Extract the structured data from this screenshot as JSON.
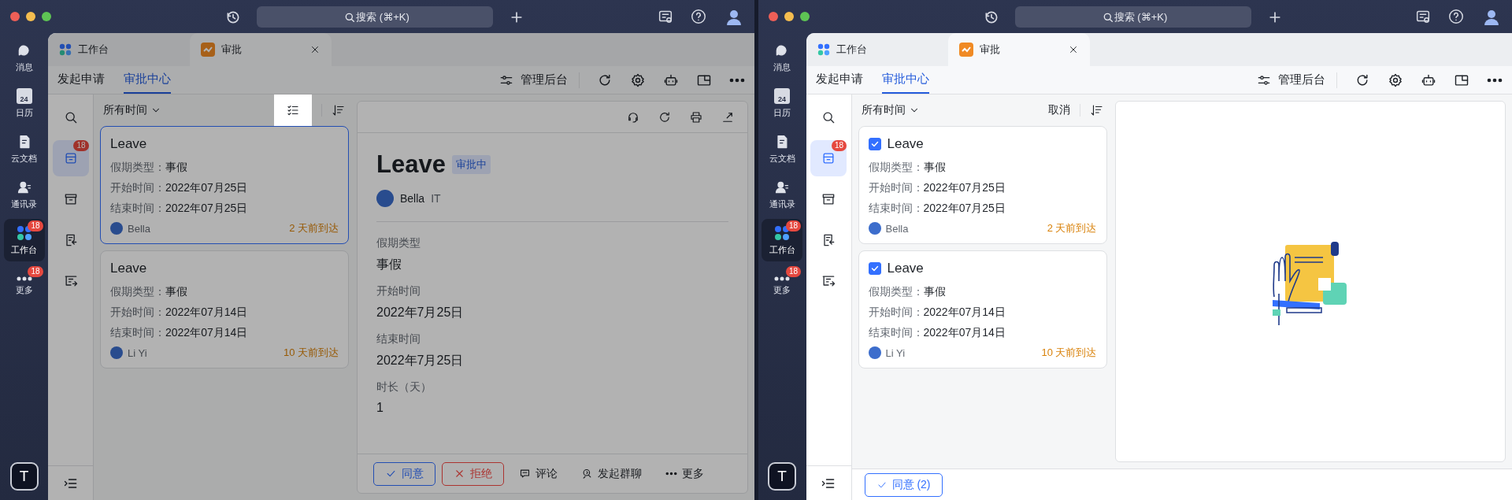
{
  "windows": [
    {
      "dimmed": true,
      "titlebar": {
        "search": {
          "placeholder": "搜索 (⌘+K)"
        }
      },
      "rail": {
        "items": [
          {
            "kind": "chat",
            "label": "消息",
            "selected": false
          },
          {
            "kind": "calendar",
            "label": "日历",
            "date": "24",
            "selected": false
          },
          {
            "kind": "docs",
            "label": "云文档",
            "selected": false
          },
          {
            "kind": "contacts",
            "label": "通讯录",
            "selected": false
          },
          {
            "kind": "workplace",
            "label": "工作台",
            "badge": "18",
            "selected": true
          },
          {
            "kind": "more",
            "label": "更多",
            "badge": "18",
            "selected": false
          }
        ],
        "workspace": "T"
      },
      "app_tabs": [
        {
          "kind": "workplace",
          "label": "工作台",
          "selected": false
        },
        {
          "kind": "approval",
          "label": "审批",
          "selected": true
        }
      ],
      "subnav": {
        "tabs": [
          {
            "label": "发起申请",
            "selected": false
          },
          {
            "label": "审批中心",
            "selected": true
          }
        ],
        "admin": "管理后台"
      },
      "side_icons": [
        {
          "kind": "search",
          "selected": false
        },
        {
          "kind": "inbox",
          "badge": "18",
          "selected": true
        },
        {
          "kind": "archive",
          "selected": false
        },
        {
          "kind": "doc-in",
          "selected": false
        },
        {
          "kind": "tray-out",
          "selected": false
        }
      ],
      "list": {
        "filter": "所有时间",
        "header_action": {
          "kind": "multi-select",
          "highlighted": true
        },
        "cards": [
          {
            "title": "Leave",
            "selected": true,
            "fields": [
              {
                "label": "假期类型：",
                "value": "事假"
              },
              {
                "label": "开始时间：",
                "value": "2022年07月25日"
              },
              {
                "label": "结束时间：",
                "value": "2022年07月25日"
              }
            ],
            "requester": "Bella",
            "arrival": "2 天前到达"
          },
          {
            "title": "Leave",
            "selected": false,
            "fields": [
              {
                "label": "假期类型：",
                "value": "事假"
              },
              {
                "label": "开始时间：",
                "value": "2022年07月14日"
              },
              {
                "label": "结束时间：",
                "value": "2022年07月14日"
              }
            ],
            "requester": "Li Yi",
            "arrival": "10 天前到达"
          }
        ]
      },
      "detail": {
        "kind": "record",
        "title": "Leave",
        "status": "审批中",
        "applicant": "Bella",
        "department": "IT",
        "fields": [
          {
            "label": "假期类型",
            "value": "事假"
          },
          {
            "label": "开始时间",
            "value": "2022年7月25日"
          },
          {
            "label": "结束时间",
            "value": "2022年7月25日"
          },
          {
            "label": "时长（天）",
            "value": "1"
          }
        ],
        "actions": [
          {
            "kind": "approve",
            "label": "同意"
          },
          {
            "kind": "reject",
            "label": "拒绝"
          },
          {
            "kind": "comment",
            "label": "评论"
          },
          {
            "kind": "group-chat",
            "label": "发起群聊"
          },
          {
            "kind": "more",
            "label": "更多"
          }
        ]
      }
    },
    {
      "titlebar": {
        "search": {
          "placeholder": "搜索 (⌘+K)"
        }
      },
      "rail": {
        "items": [
          {
            "kind": "chat",
            "label": "消息",
            "selected": false
          },
          {
            "kind": "calendar",
            "label": "日历",
            "date": "24",
            "selected": false
          },
          {
            "kind": "docs",
            "label": "云文档",
            "selected": false
          },
          {
            "kind": "contacts",
            "label": "通讯录",
            "selected": false
          },
          {
            "kind": "workplace",
            "label": "工作台",
            "badge": "18",
            "selected": true
          },
          {
            "kind": "more",
            "label": "更多",
            "badge": "18",
            "selected": false
          }
        ],
        "workspace": "T"
      },
      "app_tabs": [
        {
          "kind": "workplace",
          "label": "工作台",
          "selected": false
        },
        {
          "kind": "approval",
          "label": "审批",
          "selected": true
        }
      ],
      "subnav": {
        "tabs": [
          {
            "label": "发起申请",
            "selected": false
          },
          {
            "label": "审批中心",
            "selected": true
          }
        ],
        "admin": "管理后台"
      },
      "side_icons": [
        {
          "kind": "search",
          "selected": false
        },
        {
          "kind": "inbox",
          "badge": "18",
          "selected": true
        },
        {
          "kind": "archive",
          "selected": false
        },
        {
          "kind": "doc-in",
          "selected": false
        },
        {
          "kind": "tray-out",
          "selected": false
        }
      ],
      "list": {
        "filter": "所有时间",
        "header_action": {
          "kind": "cancel",
          "label": "取消"
        },
        "cards": [
          {
            "title": "Leave",
            "checked": true,
            "selected": false,
            "fields": [
              {
                "label": "假期类型：",
                "value": "事假"
              },
              {
                "label": "开始时间：",
                "value": "2022年07月25日"
              },
              {
                "label": "结束时间：",
                "value": "2022年07月25日"
              }
            ],
            "requester": "Bella",
            "arrival": "2 天前到达"
          },
          {
            "title": "Leave",
            "checked": true,
            "selected": false,
            "fields": [
              {
                "label": "假期类型：",
                "value": "事假"
              },
              {
                "label": "开始时间：",
                "value": "2022年07月14日"
              },
              {
                "label": "结束时间：",
                "value": "2022年07月14日"
              }
            ],
            "requester": "Li Yi",
            "arrival": "10 天前到达"
          }
        ]
      },
      "detail": {
        "kind": "empty"
      },
      "footer": {
        "actions": [
          {
            "kind": "approve",
            "label": "同意 (2)"
          }
        ]
      }
    }
  ]
}
